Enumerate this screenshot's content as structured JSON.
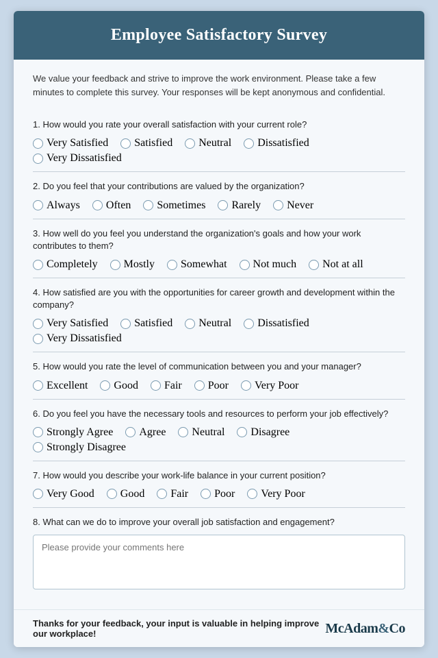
{
  "header": {
    "title": "Employee Satisfactory Survey"
  },
  "intro": "We value your feedback and strive to improve the work environment. Please take a few minutes to complete this survey. Your responses will be kept anonymous and confidential.",
  "questions": [
    {
      "id": "q1",
      "text": "1. How would you rate your overall satisfaction with your current role?",
      "type": "radio",
      "options": [
        "Very Satisfied",
        "Satisfied",
        "Neutral",
        "Dissatisfied",
        "Very Dissatisfied"
      ]
    },
    {
      "id": "q2",
      "text": "2. Do you feel that your contributions are valued by the organization?",
      "type": "radio",
      "options": [
        "Always",
        "Often",
        "Sometimes",
        "Rarely",
        "Never"
      ]
    },
    {
      "id": "q3",
      "text": "3. How well do you feel you understand the organization's goals and how your work contributes to them?",
      "type": "radio",
      "options": [
        "Completely",
        "Mostly",
        "Somewhat",
        "Not much",
        "Not at all"
      ]
    },
    {
      "id": "q4",
      "text": "4. How satisfied are you with the opportunities for career growth and development within the company?",
      "type": "radio",
      "options": [
        "Very Satisfied",
        "Satisfied",
        "Neutral",
        "Dissatisfied",
        "Very Dissatisfied"
      ]
    },
    {
      "id": "q5",
      "text": "5. How would you rate the level of communication between you and your manager?",
      "type": "radio",
      "options": [
        "Excellent",
        "Good",
        "Fair",
        "Poor",
        "Very Poor"
      ]
    },
    {
      "id": "q6",
      "text": "6. Do you feel you have the necessary tools and resources to perform your job effectively?",
      "type": "radio",
      "options": [
        "Strongly Agree",
        "Agree",
        "Neutral",
        "Disagree",
        "Strongly Disagree"
      ]
    },
    {
      "id": "q7",
      "text": "7. How would you describe your work-life balance in your current position?",
      "type": "radio",
      "options": [
        "Very Good",
        "Good",
        "Fair",
        "Poor",
        "Very Poor"
      ]
    },
    {
      "id": "q8",
      "text": "8. What can we do to improve your overall job satisfaction and engagement?",
      "type": "textarea",
      "placeholder": "Please provide your comments here"
    }
  ],
  "footer": {
    "text": "Thanks for your feedback, your input is valuable in helping improve our workplace!",
    "brand": "McAdam&Co"
  }
}
